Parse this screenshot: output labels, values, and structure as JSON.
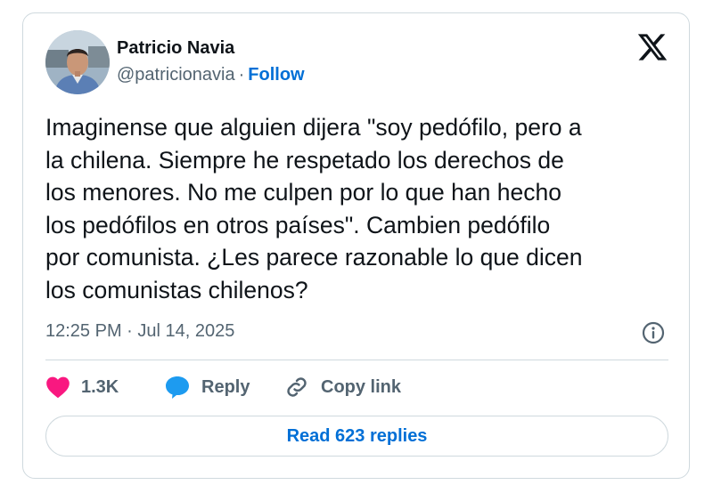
{
  "author": {
    "name": "Patricio Navia",
    "handle": "@patricionavia",
    "separator": "·",
    "follow_label": "Follow"
  },
  "tweet": {
    "text": "Imaginense que alguien dijera \"soy pedófilo, pero a\nla chilena. Siempre he respetado los derechos de\nlos menores. No me culpen por lo que han hecho\nlos pedófilos en otros países\". Cambien pedófilo\npor comunista. ¿Les parece razonable lo que dicen\nlos comunistas chilenos?",
    "timestamp": "12:25 PM · Jul 14, 2025"
  },
  "actions": {
    "likes": "1.3K",
    "reply_label": "Reply",
    "copy_link_label": "Copy link"
  },
  "replies_button": "Read 623 replies",
  "icons": {
    "platform": "x-logo-icon",
    "like": "heart-icon",
    "reply": "speech-bubble-icon",
    "copy": "link-icon",
    "info": "info-icon"
  },
  "colors": {
    "link": "#006fd6",
    "heart": "#f91880",
    "reply_bubble": "#1d9bf0",
    "muted_text": "#536471",
    "border": "#cfd9de"
  }
}
